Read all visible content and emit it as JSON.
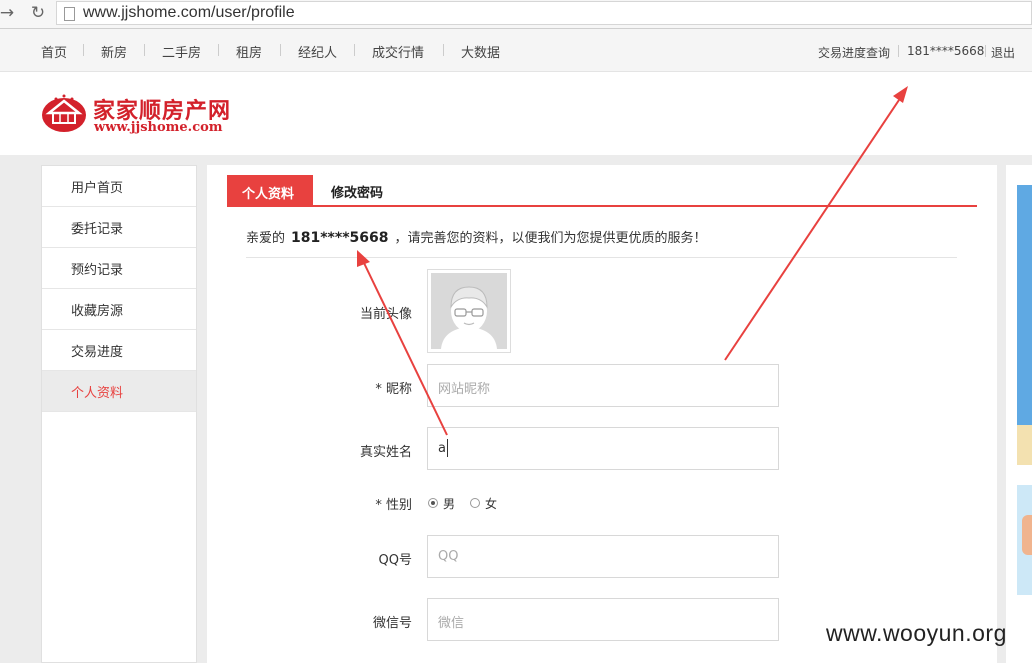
{
  "browser": {
    "url": "www.jjshome.com/user/profile",
    "back_icon": "back-arrow-icon",
    "reload_icon": "reload-icon"
  },
  "topnav": {
    "items": [
      "首页",
      "新房",
      "二手房",
      "租房",
      "经纪人",
      "成交行情",
      "大数据"
    ],
    "right": {
      "progress_query": "交易进度查询",
      "phone": "181****5668",
      "logout": "退出"
    }
  },
  "logo": {
    "cn": "家家顺房产网",
    "en": "www.jjshome.com",
    "mark_text": "JJJHome",
    "color": "#d3212b"
  },
  "sidebar": {
    "items": [
      "用户首页",
      "委托记录",
      "预约记录",
      "收藏房源",
      "交易进度",
      "个人资料"
    ],
    "active_index": 5
  },
  "tabs": {
    "active": "个人资料",
    "other": "修改密码"
  },
  "greeting": {
    "prefix": "亲爱的",
    "name": "181****5668",
    "suffix": "，请完善您的资料，以便我们为您提供更优质的服务！"
  },
  "form": {
    "avatar_label": "当前头像",
    "nickname_label": "* 昵称",
    "nickname_placeholder": "网站昵称",
    "realname_label": "真实姓名",
    "realname_value": "a",
    "gender_label": "* 性别",
    "gender_male": "男",
    "gender_female": "女",
    "gender_selected": "男",
    "qq_label": "QQ号",
    "qq_placeholder": "QQ",
    "wechat_label": "微信号",
    "wechat_placeholder": "微信"
  },
  "watermark": "www.wooyun.org",
  "colors": {
    "accent": "#e8413f",
    "annotation_arrow": "#e8413f"
  }
}
